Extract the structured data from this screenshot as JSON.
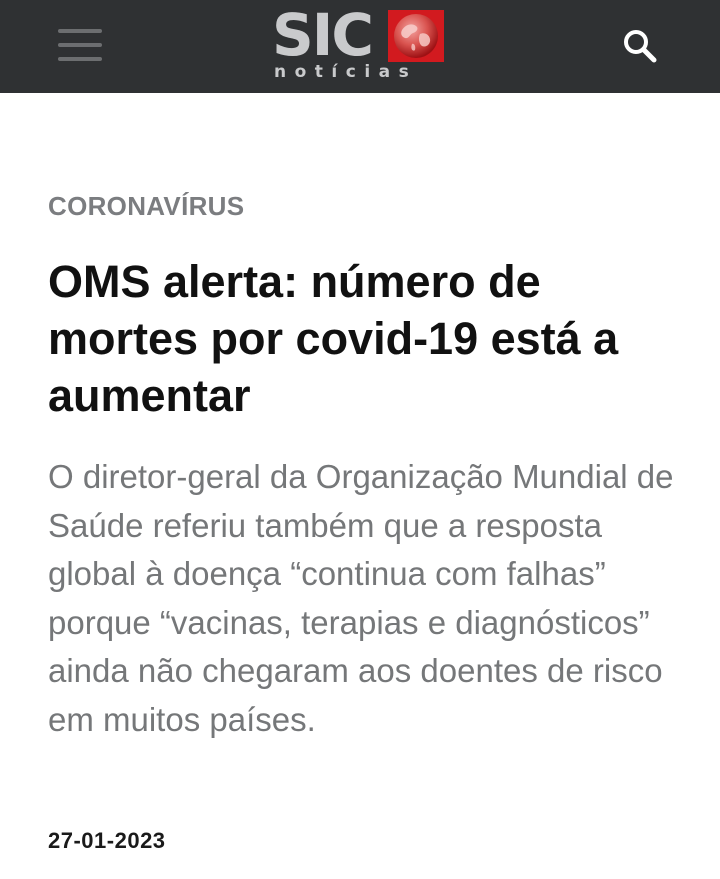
{
  "header": {
    "logo_text": "SIC",
    "logo_subtext": "notícias",
    "menu_icon": "hamburger-menu-icon",
    "search_icon": "search-icon",
    "background_color": "#2f3133"
  },
  "article": {
    "category": "CORONAVÍRUS",
    "title": "OMS alerta: número de mortes por covid-19 está a aumentar",
    "lead": "O diretor-geral da Organização Mundial de Saúde referiu também que a resposta global à doença “continua com falhas” porque “vacinas, terapias e diagnósticos” ainda não chegaram aos doentes de risco em muitos países.",
    "date": "27-01-2023"
  },
  "colors": {
    "brand_red": "#d21a1f",
    "category_gray": "#7b7d80",
    "lead_gray": "#757779"
  }
}
